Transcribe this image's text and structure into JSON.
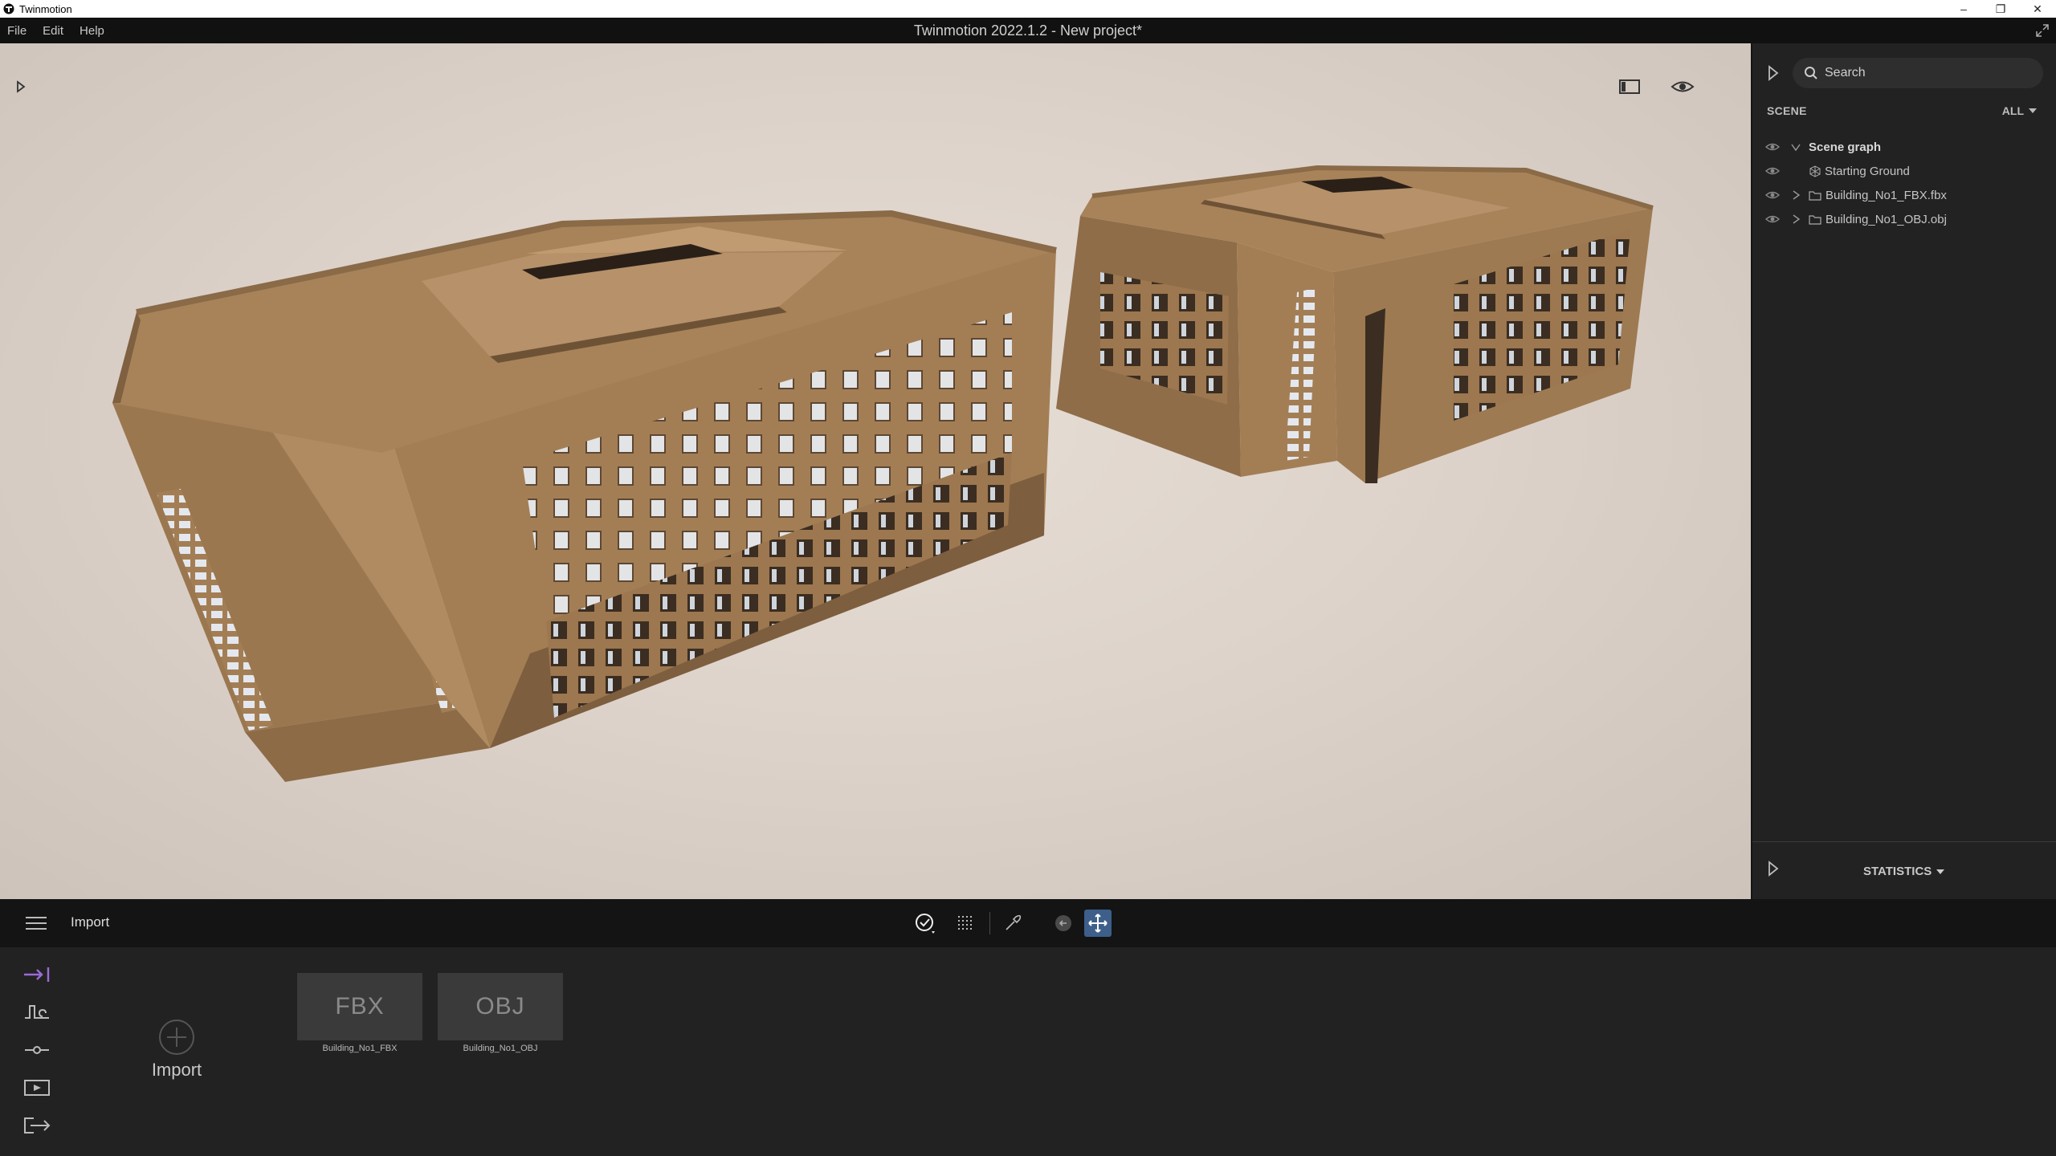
{
  "os_window": {
    "app_name": "Twinmotion",
    "controls": {
      "minimize": "–",
      "restore": "❐",
      "close": "✕"
    }
  },
  "menubar": {
    "items": [
      "File",
      "Edit",
      "Help"
    ],
    "title": "Twinmotion 2022.1.2 - New project*"
  },
  "scene_panel": {
    "search": {
      "placeholder": "Search"
    },
    "section_label": "SCENE",
    "filter_label": "ALL",
    "tree": [
      {
        "label": "Scene graph"
      },
      {
        "label": "Starting Ground"
      },
      {
        "label": "Building_No1_FBX.fbx"
      },
      {
        "label": "Building_No1_OBJ.obj"
      }
    ],
    "statistics_label": "STATISTICS"
  },
  "toolbar": {
    "section_title": "Import"
  },
  "import_panel": {
    "import_label": "Import",
    "assets": [
      {
        "thumb_text": "FBX",
        "name": "Building_No1_FBX"
      },
      {
        "thumb_text": "OBJ",
        "name": "Building_No1_OBJ"
      }
    ]
  },
  "colors": {
    "building": "#a37e55",
    "building_shadow": "#7a5b3b",
    "ground": "#ddd3cb",
    "accent_purple": "#9b6bd6",
    "active_tool": "#3d5f8a"
  }
}
